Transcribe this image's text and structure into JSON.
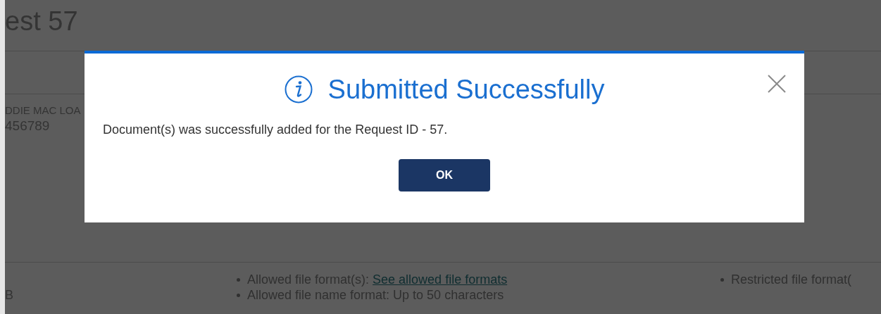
{
  "page": {
    "title": "est 57",
    "field_label": "DDIE MAC LOA",
    "field_value": "456789",
    "column_1": "B",
    "allowed": [
      {
        "label": "Allowed file format(s): ",
        "link": "See allowed file formats"
      },
      {
        "label": "Allowed file name format: Up to 50 characters"
      }
    ],
    "restricted": [
      {
        "label": "Restricted file format("
      }
    ]
  },
  "dialog": {
    "title": "Submitted Successfully",
    "message": "Document(s) was successfully added for the Request ID - 57.",
    "buttons": [
      "OK"
    ]
  }
}
